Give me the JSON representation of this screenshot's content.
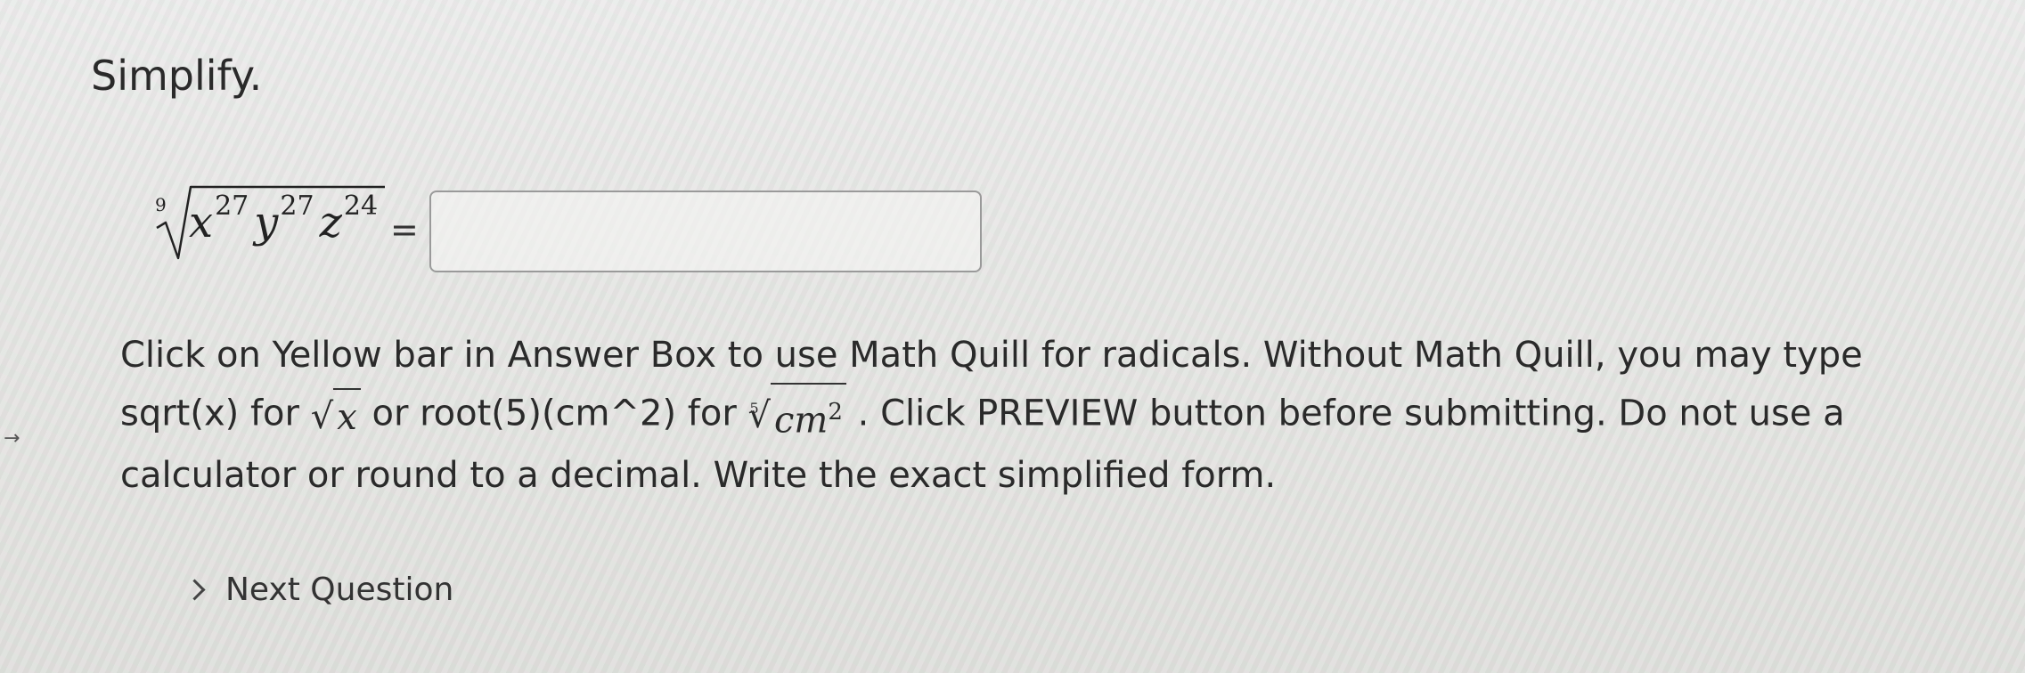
{
  "problem": {
    "title": "Simplify.",
    "root_index": "9",
    "radicand": {
      "base1": "x",
      "exp1": "27",
      "base2": "y",
      "exp2": "27",
      "base3": "z",
      "exp3": "24"
    },
    "equals": "=",
    "answer_value": ""
  },
  "instructions": {
    "part1": "Click on Yellow bar in Answer Box to use Math Quill for radicals. Without Math Quill, you may type sqrt(x) for",
    "sqrt_example_var": "x",
    "part2": "or  root(5)(cm^2) for",
    "root_example_index": "5",
    "root_example_base": "cm",
    "root_example_exp": "2",
    "part3": ". Click PREVIEW button before submitting. Do not use a calculator or round to a decimal. Write the exact simplified form."
  },
  "nav": {
    "next_question_label": "Next Question"
  }
}
